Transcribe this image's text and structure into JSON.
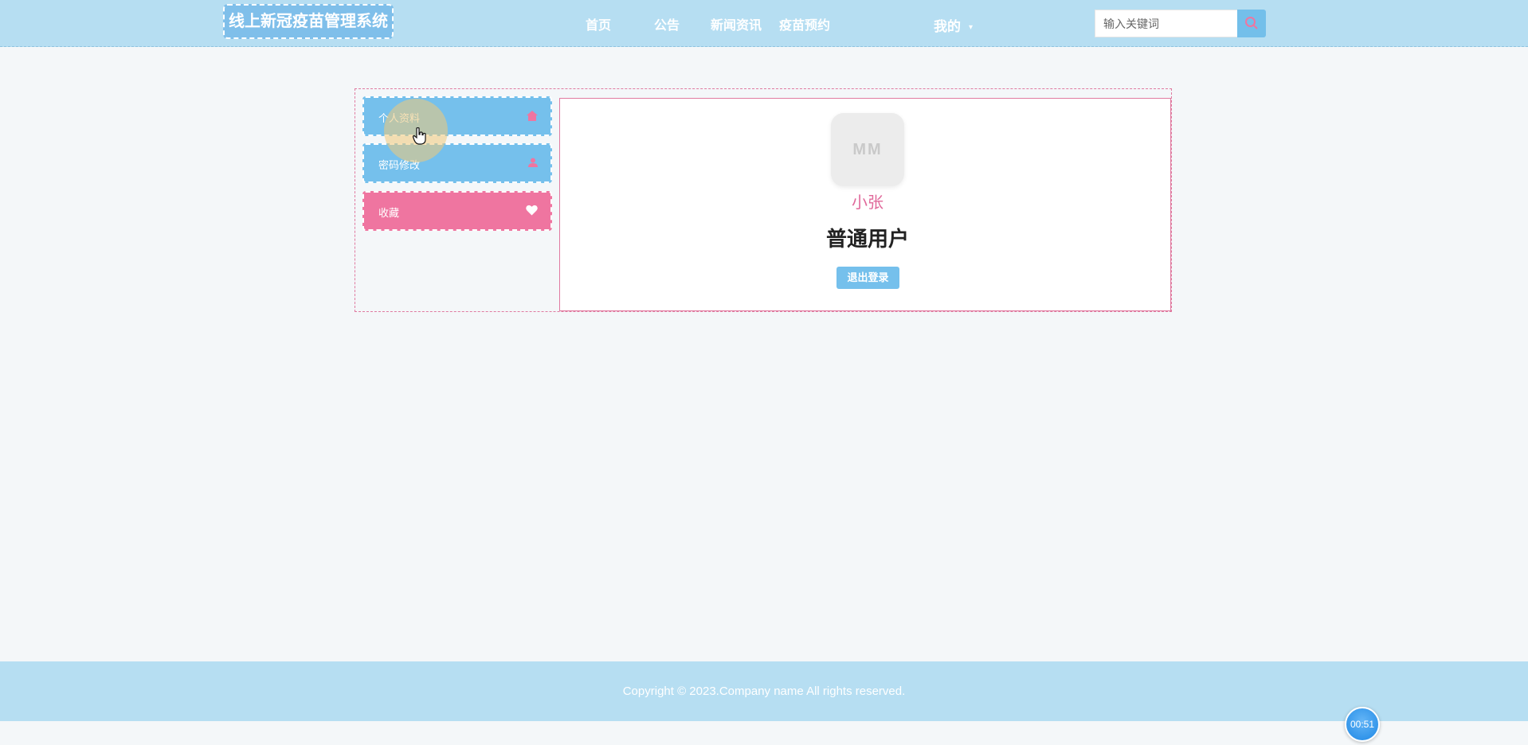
{
  "header": {
    "logo_text": "线上新冠疫苗管理系统",
    "nav": [
      {
        "label": "首页"
      },
      {
        "label": "公告"
      },
      {
        "label": "新闻资讯"
      },
      {
        "label": "疫苗预约"
      }
    ],
    "me_menu_label": "我的",
    "search": {
      "placeholder": "输入关键词",
      "value": ""
    }
  },
  "sidebar": {
    "items": [
      {
        "label": "个人资料",
        "icon": "home-icon",
        "color": "#75c0ec"
      },
      {
        "label": "密码修改",
        "icon": "user-icon",
        "color": "#75c0ec"
      },
      {
        "label": "收藏",
        "icon": "heart-icon",
        "color": "#ef75a0"
      }
    ]
  },
  "profile": {
    "avatar_text": "MM",
    "username": "小张",
    "role": "普通用户",
    "logout_label": "退出登录"
  },
  "footer": {
    "copyright": "Copyright © 2023.Company name All rights reserved."
  },
  "timer": {
    "value": "00:51"
  },
  "colors": {
    "header_bg": "#b6def2",
    "accent_blue": "#75c0ec",
    "accent_pink": "#ef75a0",
    "username_pink": "#e0689a"
  }
}
